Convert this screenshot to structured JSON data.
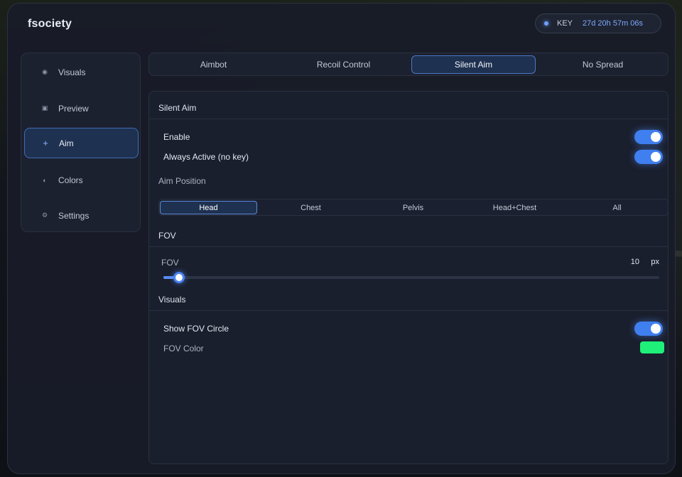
{
  "app": {
    "title": "fsociety"
  },
  "license": {
    "label": "KEY",
    "time_left": "27d 20h 57m 06s"
  },
  "sidebar": {
    "items": [
      {
        "label": "Visuals",
        "icon": "dot-icon",
        "active": false
      },
      {
        "label": "Preview",
        "icon": "square-icon",
        "active": false
      },
      {
        "label": "Aim",
        "icon": "crosshair-icon",
        "active": true
      },
      {
        "label": "Colors",
        "icon": "half-circle-icon",
        "active": false
      },
      {
        "label": "Settings",
        "icon": "gear-icon",
        "active": false
      }
    ]
  },
  "tabs": [
    {
      "label": "Aimbot",
      "active": false
    },
    {
      "label": "Recoil Control",
      "active": false
    },
    {
      "label": "Silent Aim",
      "active": true
    },
    {
      "label": "No Spread",
      "active": false
    }
  ],
  "silent_aim": {
    "title": "Silent Aim",
    "enable": {
      "label": "Enable",
      "on": true
    },
    "always_active": {
      "label": "Always Active (no key)",
      "on": true
    },
    "aim_position": {
      "label": "Aim Position",
      "options": [
        "Head",
        "Chest",
        "Pelvis",
        "Head+Chest",
        "All"
      ],
      "selected": "Head"
    }
  },
  "fov": {
    "title": "FOV",
    "label": "FOV",
    "value": "10",
    "unit": "px",
    "fraction": 0.02
  },
  "visuals": {
    "title": "Visuals",
    "show_fov_circle": {
      "label": "Show FOV Circle",
      "on": true
    },
    "fov_color": {
      "label": "FOV Color",
      "color": "#1ef07a"
    }
  },
  "colors": {
    "accent": "#3f7ff0"
  }
}
